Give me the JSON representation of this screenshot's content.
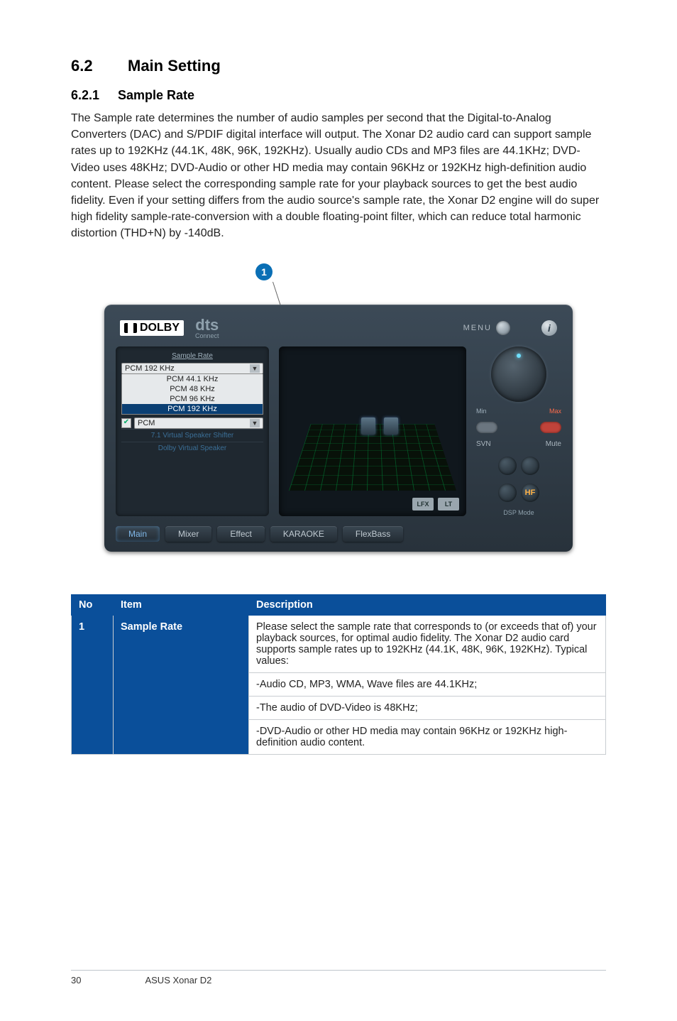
{
  "section": {
    "number": "6.2",
    "title": "Main Setting"
  },
  "subsection": {
    "number": "6.2.1",
    "title": "Sample Rate"
  },
  "body": "The Sample rate determines the number of audio samples per second that the Digital-to-Analog Converters (DAC) and S/PDIF digital interface will output. The Xonar D2 audio card can support sample rates up to 192KHz (44.1K, 48K, 96K, 192KHz). Usually audio CDs and MP3 files are 44.1KHz; DVD-Video uses 48KHz; DVD-Audio or other HD media may contain 96KHz or 192KHz high-definition audio content. Please select the corresponding sample rate for your playback sources to get the best audio fidelity. Even if your setting differs from the audio source's sample rate, the Xonar D2 engine will do super high fidelity sample-rate-conversion with a double floating-point filter, which can reduce total harmonic distortion (THD+N) by -140dB.",
  "callout": "1",
  "panel": {
    "dolby": "DOLBY",
    "dts": "dts",
    "dts_sub": "Connect",
    "menu": "MENU",
    "info": "i",
    "sample_rate_label": "Sample Rate",
    "combo_value": "PCM 192 KHz",
    "options": [
      "PCM 44.1 KHz",
      "PCM 48 KHz",
      "PCM 96 KHz",
      "PCM 192 KHz"
    ],
    "selected_index": 3,
    "pcm_check": "✔",
    "pcm_label": "PCM",
    "dim1": "7.1 Virtual Speaker Shifter",
    "dim2": "Dolby Virtual Speaker",
    "bi1": "LFX",
    "bi2": "LT",
    "min": "Min",
    "max": "Max",
    "svn": "SVN",
    "mute": "Mute",
    "hf": "HF",
    "dsp": "DSP Mode",
    "tabs": [
      "Main",
      "Mixer",
      "Effect",
      "KARAOKE",
      "FlexBass"
    ]
  },
  "table": {
    "headers": {
      "no": "No",
      "item": "Item",
      "desc": "Description"
    },
    "row_no": "1",
    "row_item": "Sample Rate",
    "desc1": "Please select the sample rate that corresponds to (or exceeds that of) your playback sources, for optimal audio fidelity. The Xonar D2 audio card supports sample rates up to 192KHz (44.1K, 48K, 96K, 192KHz). Typical values:",
    "desc2": "-Audio CD, MP3, WMA, Wave files are 44.1KHz;",
    "desc3": "-The audio of DVD-Video is 48KHz;",
    "desc4": "-DVD-Audio or other HD media may contain 96KHz or 192KHz high-definition audio content."
  },
  "footer": {
    "page": "30",
    "product": "ASUS Xonar D2"
  }
}
